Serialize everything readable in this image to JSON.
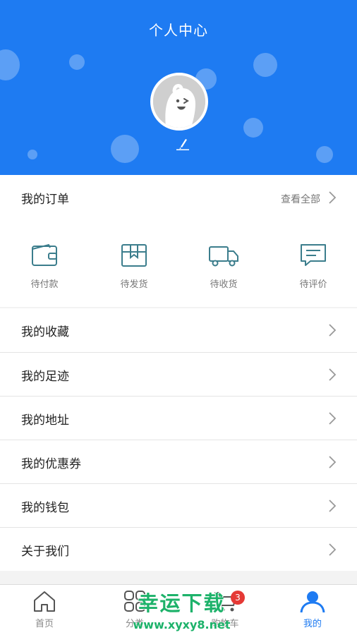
{
  "header": {
    "title": "个人中心",
    "color": "#1e7bf2",
    "avatar_icon": "avatar-mascot",
    "edit_icon": "pencil-icon"
  },
  "orders": {
    "title": "我的订单",
    "view_all": "查看全部",
    "statuses": [
      {
        "label": "待付款",
        "icon": "wallet-icon"
      },
      {
        "label": "待发货",
        "icon": "package-icon"
      },
      {
        "label": "待收货",
        "icon": "truck-icon"
      },
      {
        "label": "待评价",
        "icon": "review-icon"
      }
    ]
  },
  "menu": [
    {
      "label": "我的收藏"
    },
    {
      "label": "我的足迹"
    },
    {
      "label": "我的地址"
    },
    {
      "label": "我的优惠券"
    },
    {
      "label": "我的钱包"
    },
    {
      "label": "关于我们"
    }
  ],
  "tabbar": {
    "active_color": "#1e7bf2",
    "tabs": [
      {
        "label": "首页",
        "icon": "home-icon"
      },
      {
        "label": "分类",
        "icon": "grid-icon"
      },
      {
        "label": "购物车",
        "icon": "cart-icon",
        "badge": "3"
      },
      {
        "label": "我的",
        "icon": "user-icon",
        "active": true
      }
    ]
  },
  "watermark": {
    "text": "幸运下载",
    "url": "www.xyxy8.net"
  }
}
